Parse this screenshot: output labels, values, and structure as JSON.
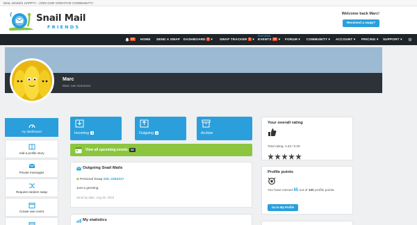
{
  "topbar": {
    "text": "MAIL MAKES HAPPY! - JOIN OUR CREATIVE COMMUNITY!"
  },
  "brand": {
    "title": "Snail Mail",
    "subtitle": "FRIENDS"
  },
  "header": {
    "welcome": "Welcome back Marc!",
    "received_button": "Received a swap?"
  },
  "nav": {
    "notifications_count": "23",
    "items": [
      {
        "label": "HOME"
      },
      {
        "label": "SEND A SWAP"
      },
      {
        "label": "DASHBOARD",
        "badge": "1"
      },
      {
        "label": "SWAP TRACKER",
        "badge": "1"
      },
      {
        "label": "EVENTS",
        "badge": "14",
        "featured": "FEATURED"
      },
      {
        "label": "FORUM"
      },
      {
        "label": "COMMUNITY"
      },
      {
        "label": "ACCOUNT"
      },
      {
        "label": "PRICING"
      },
      {
        "label": "SUPPORT"
      }
    ]
  },
  "profile": {
    "username": "Marc",
    "real_name": "Marc van Someren"
  },
  "sidebar": {
    "items": [
      {
        "label": "my dashboard",
        "icon": "dashboard-icon"
      },
      {
        "label": "Add a profile story",
        "icon": "book-icon"
      },
      {
        "label": "Private messages",
        "icon": "message-icon"
      },
      {
        "label": "Request random swap",
        "icon": "shuffle-icon"
      },
      {
        "label": "Create own event",
        "icon": "calendar-icon"
      },
      {
        "label": "",
        "icon": "calendar-icon"
      }
    ]
  },
  "quick": {
    "incoming": {
      "label": "Incoming",
      "count": "2"
    },
    "outgoing": {
      "label": "Outgoing",
      "count": "1"
    },
    "archive": {
      "label": "Archive"
    }
  },
  "upcoming": {
    "label": "View all upcoming events",
    "count": "14"
  },
  "outgoing_mails": {
    "title": "Outgoing Snail Mails",
    "swap_type": "Personal Swap",
    "swap_id": "SSL-2252317",
    "message": "Just a greeting",
    "send_by": "Send by date: Aug 26, 2023"
  },
  "stats": {
    "title": "My statistics"
  },
  "rating": {
    "title": "Your overall rating",
    "total": "Total rating: 4.53 / 5.00",
    "value": 4.53,
    "max": 5
  },
  "points": {
    "title": "Profile points",
    "prefix": "You have earned",
    "earned": "85",
    "middle": "out of",
    "total": "100",
    "suffix": "profile points.",
    "button": "Go to My Profile"
  },
  "colors": {
    "accent": "#2a9fdb",
    "green": "#8cc63f",
    "dark": "#1f2428",
    "badge": "#e8542c",
    "banner": "#9dbad3"
  }
}
